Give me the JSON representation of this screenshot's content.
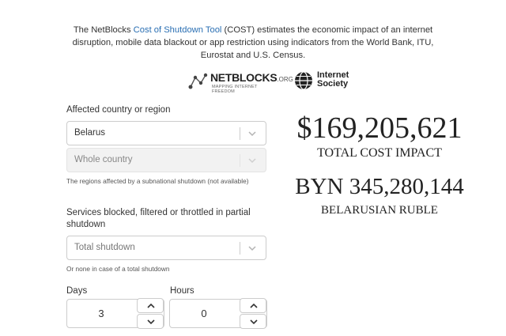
{
  "intro": {
    "text_before": "The NetBlocks ",
    "link": "Cost of Shutdown Tool",
    "text_after": " (COST) estimates the economic impact of an internet disruption, mobile data blackout or app restriction using indicators from the World Bank, ITU, Eurostat and U.S. Census."
  },
  "logos": {
    "netblocks_name": "NETBLOCKS",
    "netblocks_org": ".ORG",
    "netblocks_tagline": "MAPPING INTERNET FREEDOM",
    "isoc_line1": "Internet",
    "isoc_line2": "Society"
  },
  "form": {
    "country_label": "Affected country or region",
    "country_value": "Belarus",
    "region_value": "Whole country",
    "region_hint": "The regions affected by a subnational shutdown (not available)",
    "services_label": "Services blocked, filtered or throttled in partial shutdown",
    "services_placeholder": "Total shutdown",
    "services_hint": "Or none in case of a total shutdown",
    "days_label": "Days",
    "days_value": "3",
    "hours_label": "Hours",
    "hours_value": "0"
  },
  "results": {
    "usd_total": "$169,205,621",
    "usd_caption": "TOTAL COST IMPACT",
    "local_total": "BYN 345,280,144",
    "local_caption": "BELARUSIAN RUBLE"
  },
  "colors": {
    "link": "#2a6fb3",
    "border": "#cccccc",
    "disabled_bg": "#f2f2f2"
  },
  "icons": [
    "netblocks-logo-icon",
    "internet-society-globe-icon",
    "chevron-down-icon",
    "chevron-up-icon"
  ]
}
